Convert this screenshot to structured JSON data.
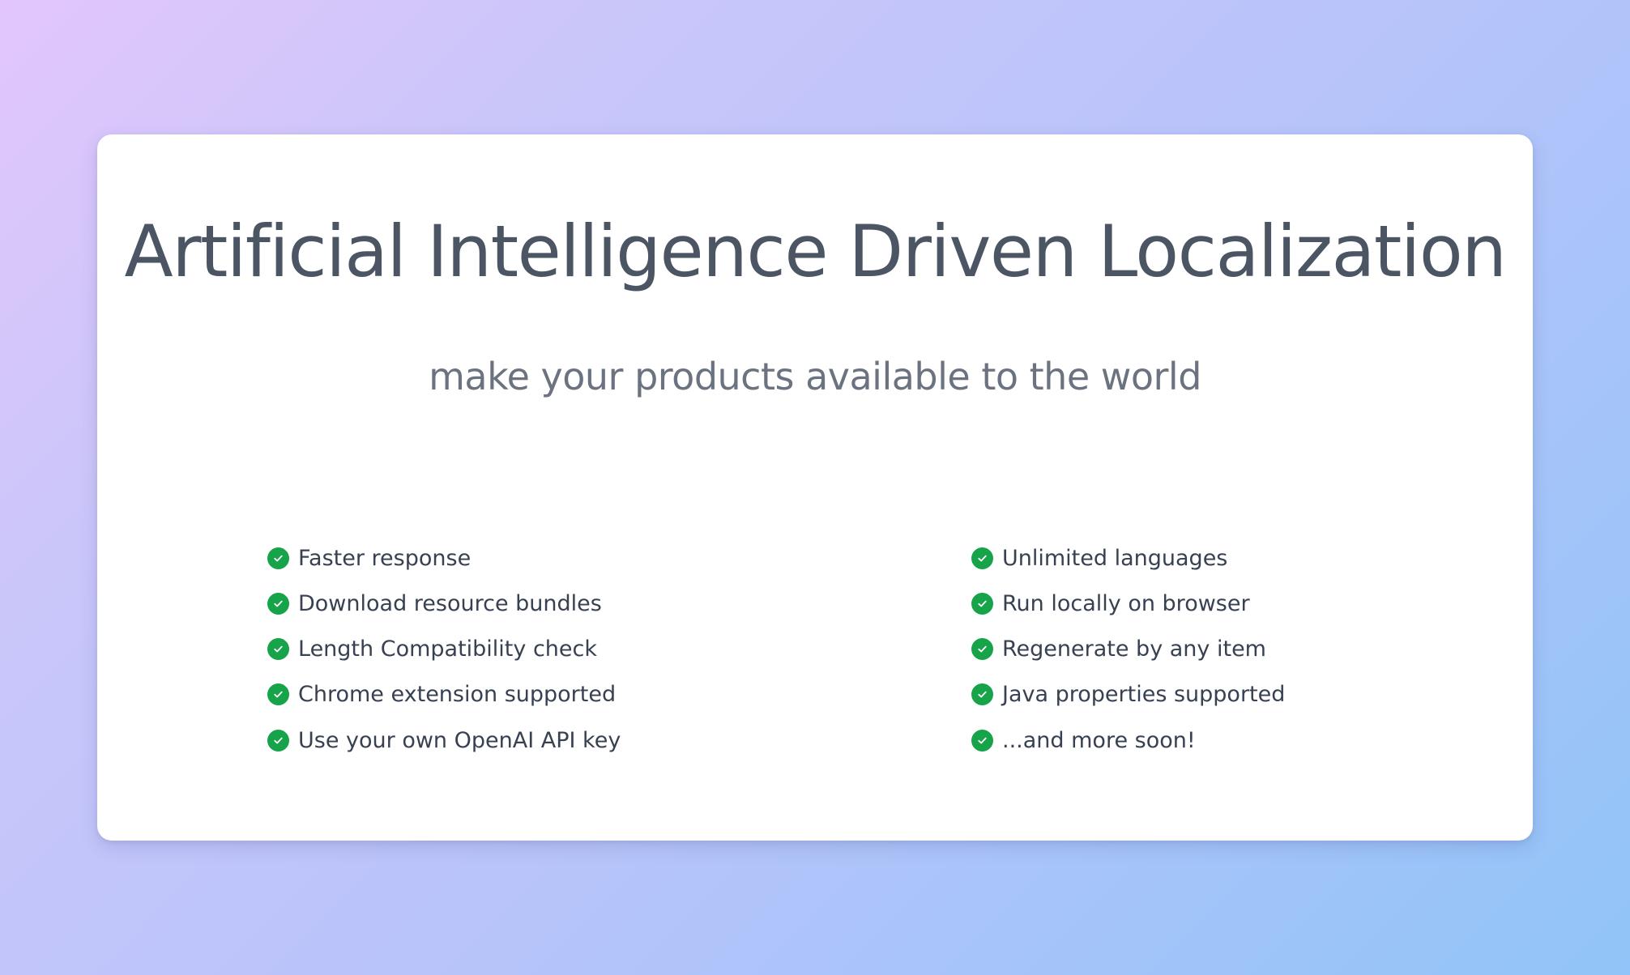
{
  "hero": {
    "title": "Artificial Intelligence Driven Localization",
    "subtitle": "make your products available to the world"
  },
  "features": {
    "icon": "check-circle-icon",
    "accent_color": "#16a34a",
    "left": [
      "Faster response",
      "Download resource bundles",
      "Length Compatibility check",
      "Chrome extension supported",
      "Use your own OpenAI API key"
    ],
    "right": [
      "Unlimited languages",
      "Run locally on browser",
      "Regenerate by any item",
      "Java properties supported",
      "...and more soon!"
    ]
  }
}
